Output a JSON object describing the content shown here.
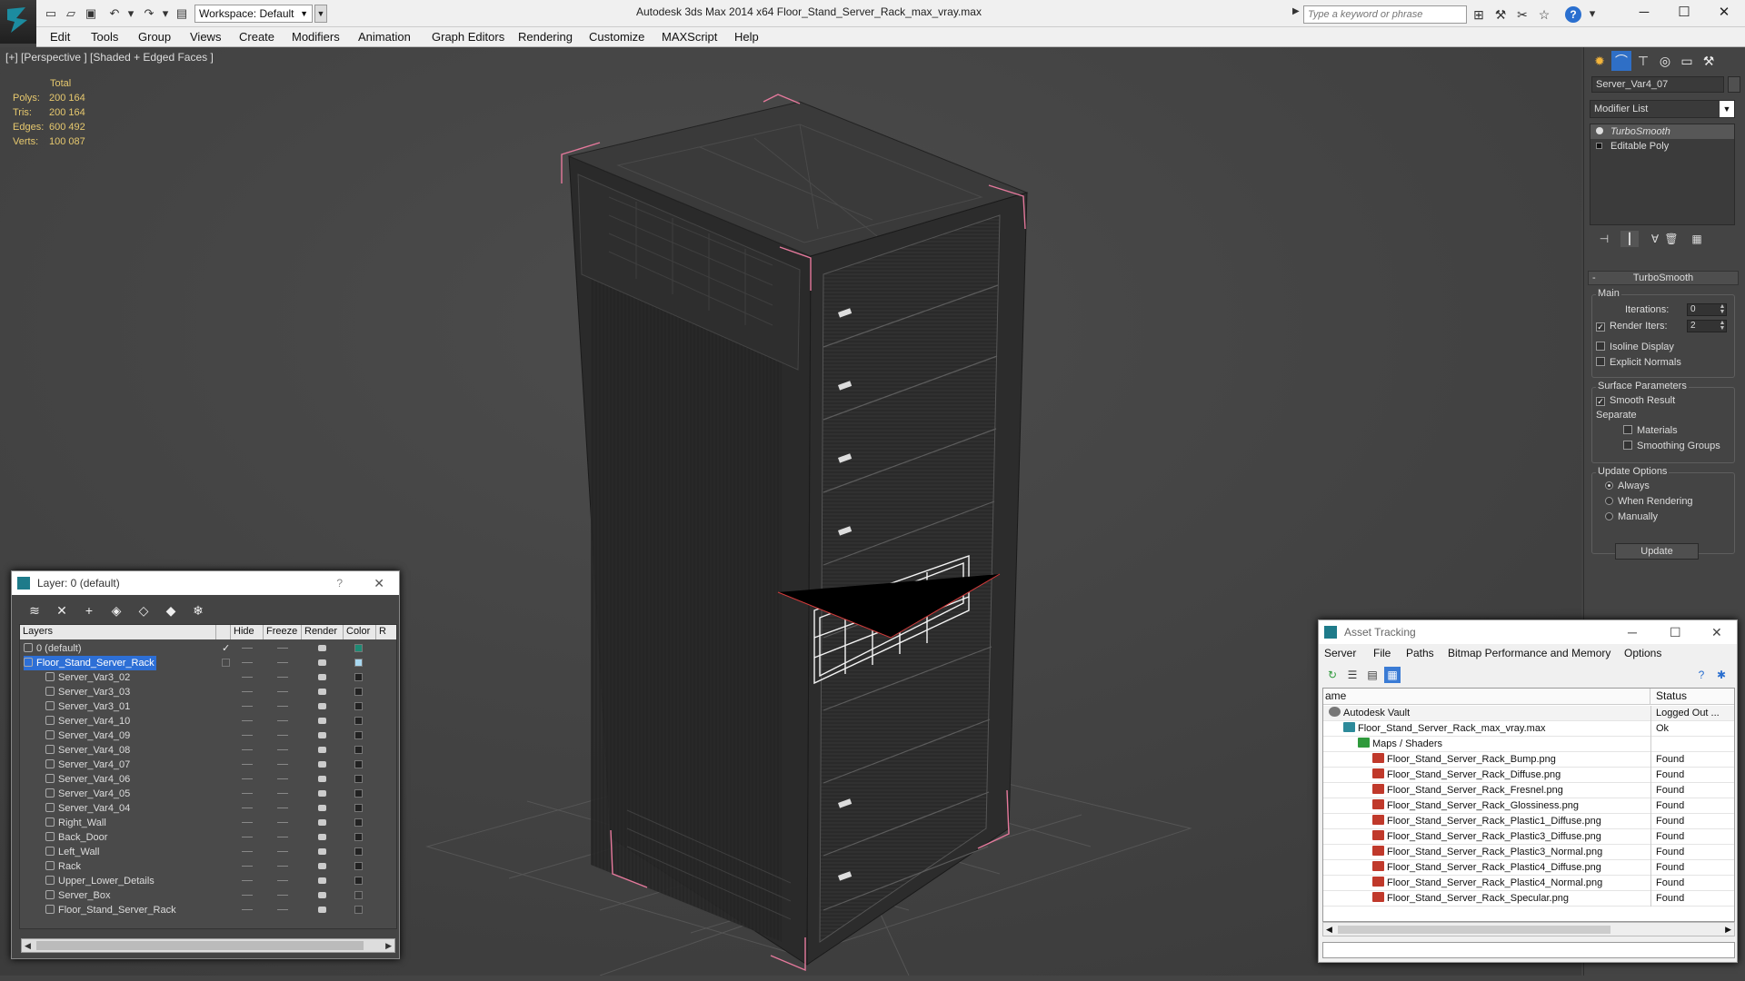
{
  "titlebar": {
    "app_title": "Autodesk 3ds Max  2014 x64      Floor_Stand_Server_Rack_max_vray.max",
    "workspace": "Workspace: Default",
    "search_placeholder": "Type a keyword or phrase"
  },
  "menu": [
    "Edit",
    "Tools",
    "Group",
    "Views",
    "Create",
    "Modifiers",
    "Animation",
    "Graph Editors",
    "Rendering",
    "Customize",
    "MAXScript",
    "Help"
  ],
  "viewport": {
    "label": "[+] [Perspective ] [Shaded + Edged Faces ]",
    "stats_header": "Total",
    "stats": [
      {
        "label": "Polys:",
        "value": "200 164"
      },
      {
        "label": "Tris:",
        "value": "200 164"
      },
      {
        "label": "Edges:",
        "value": "600 492"
      },
      {
        "label": "Verts:",
        "value": "100 087"
      }
    ]
  },
  "command_panel": {
    "object_name": "Server_Var4_07",
    "modifier_list": "Modifier List",
    "stack": [
      "TurboSmooth",
      "Editable Poly"
    ],
    "rollout_title": "TurboSmooth",
    "main_label": "Main",
    "iterations_label": "Iterations:",
    "iterations_value": "0",
    "render_iters_label": "Render Iters:",
    "render_iters_value": "2",
    "isoline": "Isoline Display",
    "explicit_normals": "Explicit Normals",
    "surface_params": "Surface Parameters",
    "smooth_result": "Smooth Result",
    "separate": "Separate",
    "materials": "Materials",
    "smoothing_groups": "Smoothing Groups",
    "update_options": "Update Options",
    "always": "Always",
    "when_rendering": "When Rendering",
    "manually": "Manually",
    "update_button": "Update"
  },
  "layer_dialog": {
    "title": "Layer: 0 (default)",
    "help": "?",
    "columns": {
      "layers": "Layers",
      "hide": "Hide",
      "freeze": "Freeze",
      "render": "Render",
      "color": "Color",
      "r": "R"
    },
    "rows": [
      {
        "name": "0 (default)",
        "indent": 0,
        "active": true,
        "selected": false,
        "color": "#1e8a74"
      },
      {
        "name": "Floor_Stand_Server_Rack",
        "indent": 0,
        "active": false,
        "selected": true,
        "color": "#a8d8f0"
      },
      {
        "name": "Server_Var3_02",
        "indent": 1,
        "color": "#222222"
      },
      {
        "name": "Server_Var3_03",
        "indent": 1,
        "color": "#222222"
      },
      {
        "name": "Server_Var3_01",
        "indent": 1,
        "color": "#222222"
      },
      {
        "name": "Server_Var4_10",
        "indent": 1,
        "color": "#222222"
      },
      {
        "name": "Server_Var4_09",
        "indent": 1,
        "color": "#222222"
      },
      {
        "name": "Server_Var4_08",
        "indent": 1,
        "color": "#222222"
      },
      {
        "name": "Server_Var4_07",
        "indent": 1,
        "color": "#222222"
      },
      {
        "name": "Server_Var4_06",
        "indent": 1,
        "color": "#222222"
      },
      {
        "name": "Server_Var4_05",
        "indent": 1,
        "color": "#222222"
      },
      {
        "name": "Server_Var4_04",
        "indent": 1,
        "color": "#222222"
      },
      {
        "name": "Right_Wall",
        "indent": 1,
        "color": "#222222"
      },
      {
        "name": "Back_Door",
        "indent": 1,
        "color": "#222222"
      },
      {
        "name": "Left_Wall",
        "indent": 1,
        "color": "#222222"
      },
      {
        "name": "Rack",
        "indent": 1,
        "color": "#222222"
      },
      {
        "name": "Upper_Lower_Details",
        "indent": 1,
        "color": "#222222"
      },
      {
        "name": "Server_Box",
        "indent": 1,
        "color": "#3a3a3a"
      },
      {
        "name": "Floor_Stand_Server_Rack",
        "indent": 1,
        "color": "#3a3a3a"
      }
    ]
  },
  "asset_dialog": {
    "title": "Asset Tracking",
    "menu": [
      "Server",
      "File",
      "Paths",
      "Bitmap Performance and Memory",
      "Options"
    ],
    "col_name": "ame",
    "col_status": "Status",
    "rows": [
      {
        "name": "Autodesk Vault",
        "indent": 0,
        "icon": "vault",
        "status": "Logged Out ..."
      },
      {
        "name": "Floor_Stand_Server_Rack_max_vray.max",
        "indent": 1,
        "icon": "max",
        "status": "Ok"
      },
      {
        "name": "Maps / Shaders",
        "indent": 2,
        "icon": "fold",
        "status": ""
      },
      {
        "name": "Floor_Stand_Server_Rack_Bump.png",
        "indent": 3,
        "icon": "png",
        "status": "Found"
      },
      {
        "name": "Floor_Stand_Server_Rack_Diffuse.png",
        "indent": 3,
        "icon": "png",
        "status": "Found"
      },
      {
        "name": "Floor_Stand_Server_Rack_Fresnel.png",
        "indent": 3,
        "icon": "png",
        "status": "Found"
      },
      {
        "name": "Floor_Stand_Server_Rack_Glossiness.png",
        "indent": 3,
        "icon": "png",
        "status": "Found"
      },
      {
        "name": "Floor_Stand_Server_Rack_Plastic1_Diffuse.png",
        "indent": 3,
        "icon": "png",
        "status": "Found"
      },
      {
        "name": "Floor_Stand_Server_Rack_Plastic3_Diffuse.png",
        "indent": 3,
        "icon": "png",
        "status": "Found"
      },
      {
        "name": "Floor_Stand_Server_Rack_Plastic3_Normal.png",
        "indent": 3,
        "icon": "png",
        "status": "Found"
      },
      {
        "name": "Floor_Stand_Server_Rack_Plastic4_Diffuse.png",
        "indent": 3,
        "icon": "png",
        "status": "Found"
      },
      {
        "name": "Floor_Stand_Server_Rack_Plastic4_Normal.png",
        "indent": 3,
        "icon": "png",
        "status": "Found"
      },
      {
        "name": "Floor_Stand_Server_Rack_Specular.png",
        "indent": 3,
        "icon": "png",
        "status": "Found"
      }
    ]
  }
}
